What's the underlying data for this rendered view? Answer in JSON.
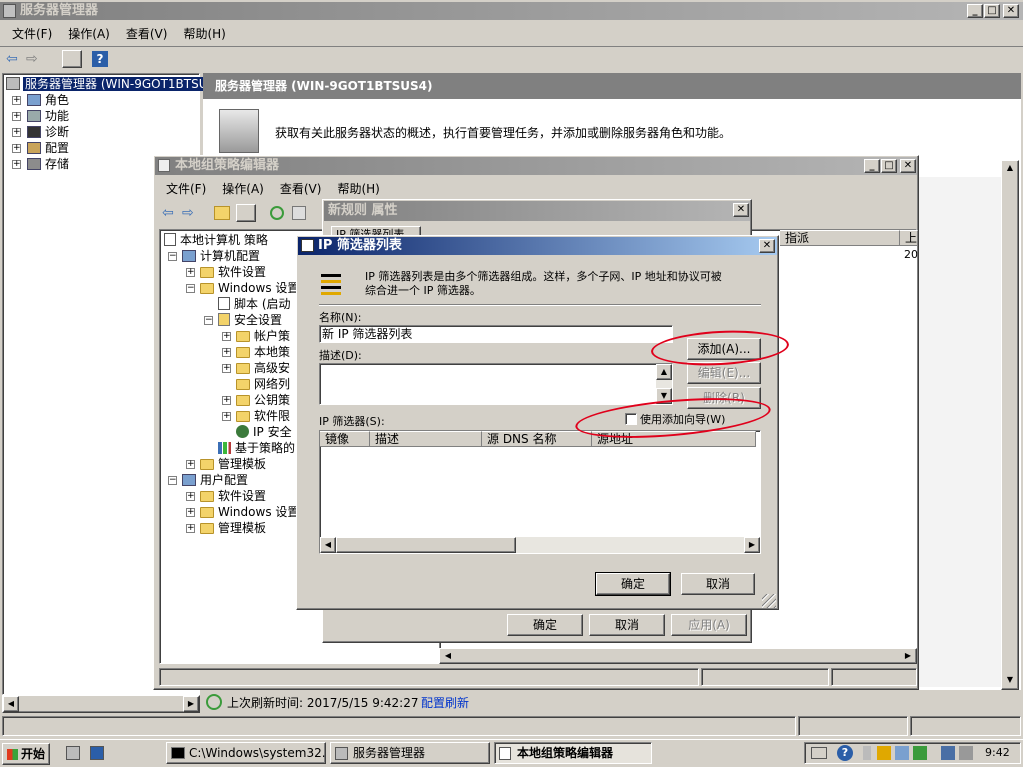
{
  "server_manager": {
    "title": "服务器管理器",
    "menu": [
      "文件(F)",
      "操作(A)",
      "查看(V)",
      "帮助(H)"
    ],
    "tree_root": "服务器管理器 (WIN-9GOT1BTSUS",
    "tree_items": [
      "角色",
      "功能",
      "诊断",
      "配置",
      "存储"
    ],
    "header_title": "服务器管理器 (WIN-9GOT1BTSUS4)",
    "description": "获取有关此服务器状态的概述，执行首要管理任务，并添加或删除服务器角色和功能。",
    "status_label": "上次刷新时间: 2017/5/15 9:42:27",
    "refresh_link": "配置刷新"
  },
  "gpedit": {
    "title": "本地组策略编辑器",
    "menu": [
      "文件(F)",
      "操作(A)",
      "查看(V)",
      "帮助(H)"
    ],
    "tree": [
      "本地计算机 策略",
      "计算机配置",
      "软件设置",
      "Windows 设置",
      "脚本 (启动",
      "安全设置",
      "帐户策",
      "本地策",
      "高级安",
      "网络列",
      "公钥策",
      "软件限",
      "IP 安全",
      "基于策略的",
      "管理模板",
      "用户配置",
      "软件设置",
      "Windows 设置",
      "管理模板"
    ],
    "right_columns": [
      "指派",
      "上"
    ],
    "right_value": "20"
  },
  "rule_props": {
    "title": "新规则 属性",
    "tab_label": "IP 筛选器列表",
    "ok": "确定",
    "cancel": "取消",
    "apply": "应用(A)"
  },
  "ip_filter_dialog": {
    "title": "IP 筛选器列表",
    "intro_line1": "IP 筛选器列表是由多个筛选器组成。这样，多个子网、IP 地址和协议可被",
    "intro_line2": "综合进一个 IP 筛选器。",
    "name_label": "名称(N):",
    "name_value": "新 IP 筛选器列表",
    "desc_label": "描述(D):",
    "add_button": "添加(A)...",
    "edit_button": "编辑(E)...",
    "remove_button": "删除(R)",
    "filters_label": "IP 筛选器(S):",
    "wizard_checkbox": "使用添加向导(W)",
    "columns": [
      "镜像",
      "描述",
      "源 DNS 名称",
      "源地址"
    ],
    "ok": "确定",
    "cancel": "取消"
  },
  "taskbar": {
    "start": "开始",
    "tasks": [
      "C:\\Windows\\system32...",
      "服务器管理器",
      "本地组策略编辑器"
    ],
    "clock": "9:42"
  },
  "colors": {
    "active_title": "#0a246a",
    "annotation_red": "#e0001b"
  }
}
